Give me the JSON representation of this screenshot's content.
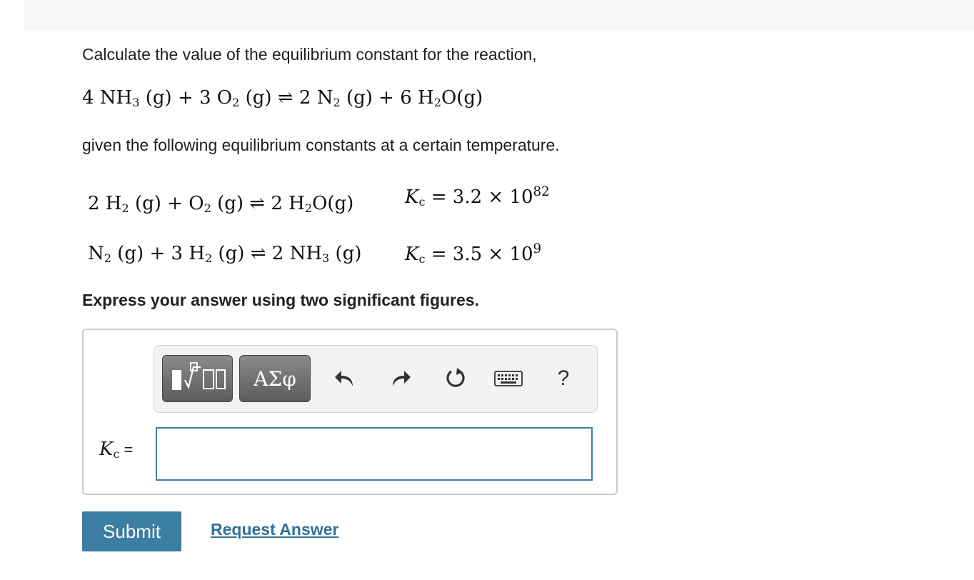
{
  "question": {
    "prompt": "Calculate the value of the equilibrium constant for the reaction,",
    "main_reaction": {
      "lhs": "4 NH",
      "lhs_sub": "3",
      "lhs_mid": " (g) + 3 O",
      "lhs_sub2": "2",
      "lhs_end": " (g) ⇌ 2 N",
      "rhs_sub": "2",
      "rhs_mid": " (g) + 6 H",
      "rhs_sub2": "2",
      "rhs_end": "O(g)"
    },
    "given_text": "given the following equilibrium constants at a certain temperature.",
    "given_reactions": [
      {
        "p1": "2 H",
        "s1": "2",
        "p2": " (g) + O",
        "s2": "2",
        "p3": " (g) ⇌ 2 H",
        "s3": "2",
        "p4": "O(g)",
        "kc_symbol": "K",
        "kc_sub": "c",
        "kc_value": " = 3.2 × 10",
        "kc_exp": "82"
      },
      {
        "p1": "N",
        "s1": "2",
        "p2": " (g) + 3 H",
        "s2": "2",
        "p3": " (g) ⇌ 2 NH",
        "s3": "3",
        "p4": " (g)",
        "kc_symbol": "K",
        "kc_sub": "c",
        "kc_value": " = 3.5 × 10",
        "kc_exp": "9"
      }
    ],
    "instruction": "Express your answer using two significant figures."
  },
  "answer": {
    "label_symbol": "K",
    "label_sub": "c",
    "label_eq": "=",
    "value": "",
    "placeholder": ""
  },
  "toolbar": {
    "symbols_label": "ΑΣφ",
    "help_label": "?",
    "icons": [
      "templates-icon",
      "undo-icon",
      "redo-icon",
      "reset-icon",
      "keyboard-icon",
      "help-icon"
    ]
  },
  "actions": {
    "submit_label": "Submit",
    "request_answer_label": "Request Answer"
  },
  "colors": {
    "submit_bg": "#3b7ea1",
    "link": "#2f7399",
    "input_border": "#3f7fa6"
  }
}
